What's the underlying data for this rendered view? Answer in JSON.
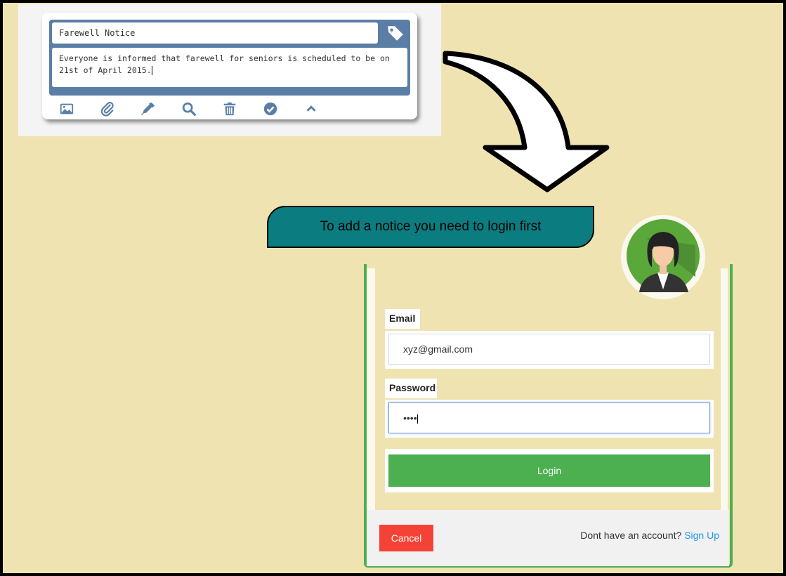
{
  "note": {
    "title": "Farewell Notice",
    "body": "Everyone is informed that farewell for seniors is scheduled to be on 21st of April 2015.",
    "tag_icon": "tag-icon",
    "toolbar_icons": [
      "image-icon",
      "paperclip-icon",
      "eyedropper-icon",
      "search-icon",
      "trash-icon",
      "check-circle-icon",
      "chevron-up-icon"
    ]
  },
  "banner": {
    "text": "To add a notice you need to login first"
  },
  "login": {
    "avatar_icon": "user-avatar-icon",
    "email_label": "Email",
    "email_value": "xyz@gmail.com",
    "password_label": "Password",
    "password_value": "••••",
    "login_label": "Login",
    "cancel_label": "Cancel",
    "signup_prompt": "Dont have an account?",
    "signup_link": "Sign Up"
  },
  "colors": {
    "background": "#efe3b1",
    "note_header": "#5a7ea6",
    "banner": "#0b7d80",
    "login_button": "#4caf50",
    "cancel_button": "#f44336",
    "link": "#2196f3"
  }
}
